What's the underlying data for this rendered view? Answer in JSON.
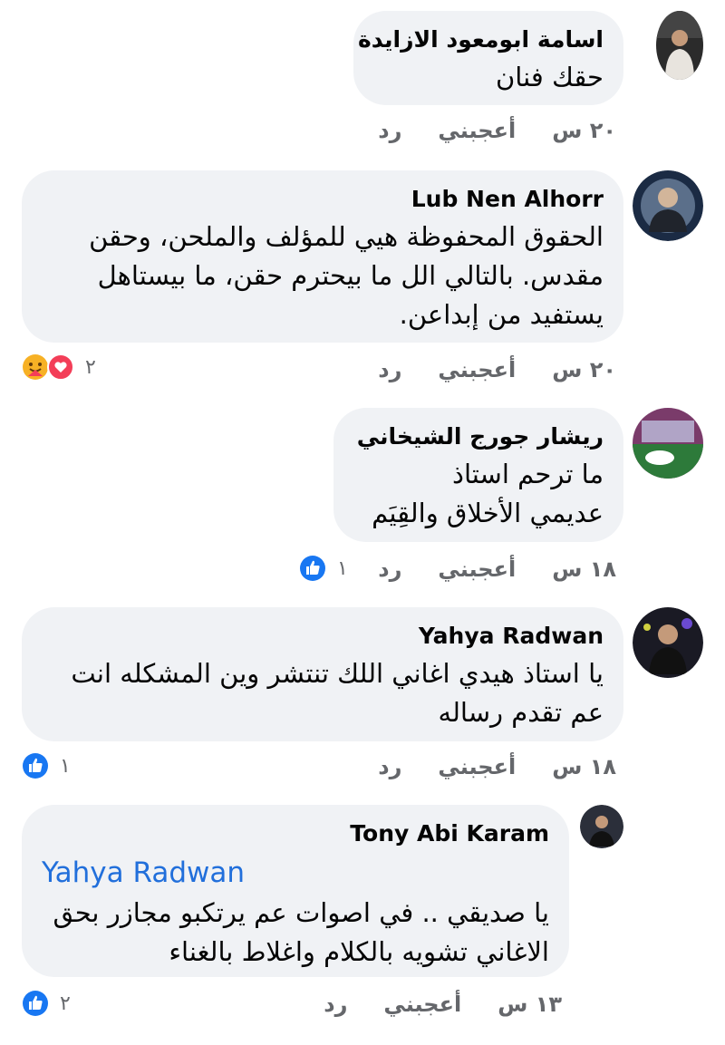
{
  "comments": [
    {
      "author": "اسامة ابومعود الازايدة",
      "text": "حقك فنان",
      "time": "٢٠ س",
      "like_label": "أعجبني",
      "reply_label": "رد",
      "reactions_count": "",
      "reactions": []
    },
    {
      "author": "Lub Nen Alhorr",
      "text": "الحقوق المحفوظة هيي للمؤلف والملحن، وحقن مقدس. بالتالي الل ما بيحترم حقن، ما بيستاهل يستفيد من إبداعن.",
      "time": "٢٠ س",
      "like_label": "أعجبني",
      "reply_label": "رد",
      "reactions_count": "٢",
      "reactions": [
        "love-icon",
        "care-icon"
      ]
    },
    {
      "author": "ريشار جورج الشيخاني",
      "text_lines": [
        "ما ترحم استاذ",
        "عديمي الأخلاق والقِيَم"
      ],
      "time": "١٨ س",
      "like_label": "أعجبني",
      "reply_label": "رد",
      "reactions_count": "١",
      "reactions": [
        "like-icon"
      ]
    },
    {
      "author": "Yahya Radwan",
      "text": "يا استاذ هيدي اغاني اللك تنتشر وين المشكله انت عم تقدم رساله",
      "time": "١٨ س",
      "like_label": "أعجبني",
      "reply_label": "رد",
      "reactions_count": "١",
      "reactions": [
        "like-icon"
      ]
    },
    {
      "author": "Tony Abi Karam",
      "mention": "Yahya Radwan",
      "text": "يا صديقي .. في اصوات عم يرتكبو مجازر بحق الاغاني تشويه بالكلام واغلاط بالغناء",
      "time": "١٣ س",
      "like_label": "أعجبني",
      "reply_label": "رد",
      "reactions_count": "٢",
      "reactions": [
        "like-icon"
      ]
    }
  ],
  "colors": {
    "bubble": "#f0f2f5",
    "meta": "#65676b",
    "mention": "#216fdb",
    "like_blue": "#1877f2",
    "love_red": "#f33e58",
    "care_yellow": "#f7b125"
  }
}
